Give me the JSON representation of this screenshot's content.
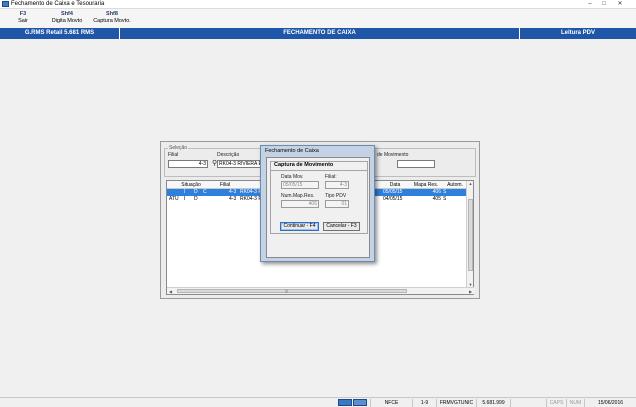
{
  "window": {
    "title": "Fechamento de Caixa e Tesouraria",
    "min": "–",
    "max": "□",
    "close": "✕"
  },
  "toolbar": [
    {
      "key": "F3",
      "label": "Sair"
    },
    {
      "key": "Shf4",
      "label": "Digita Movto"
    },
    {
      "key": "Shf8",
      "label": "Captura Movto."
    }
  ],
  "header": {
    "system": "G.RMS Retail 5.681 RMS",
    "screen": "FECHAMENTO DE CAIXA",
    "mode": "Leitura PDV"
  },
  "selection": {
    "legend": "Seleção",
    "filial_label": "Filial",
    "filial_value": "4-3",
    "descricao_label": "Descrição",
    "descricao_value": "RK04-3 RIVIERA E",
    "data_mov_label": "de Movimento",
    "data_mov_value": ""
  },
  "grid": {
    "headers": [
      "Situação",
      "Filial",
      "Data",
      "Mapa Res.",
      "Autom."
    ],
    "rows": [
      {
        "s1": "",
        "s2": "I",
        "s3": "D",
        "s4": "C",
        "filial_num": "4-3",
        "filial_desc": "RK04-3 R",
        "data": "05/05/15",
        "mapa": "406",
        "autom": "S",
        "selected": true
      },
      {
        "s1": "ATU",
        "s2": "I",
        "s3": "D",
        "s4": "",
        "filial_num": "4-3",
        "filial_desc": "RK04-3 RI",
        "data": "04/05/15",
        "mapa": "405",
        "autom": "S",
        "selected": false
      }
    ],
    "hscroll_grip": "|||"
  },
  "dialog": {
    "title": "Fechamento de Caixa",
    "heading": "Captura de Movimento",
    "data_mov_label": "Data Mov.",
    "data_mov_value": "05/05/15",
    "filial_label": "Filial:",
    "filial_value": "4-3",
    "num_map_label": "Num.Map.Res.",
    "num_map_value": "406",
    "tipo_pdv_label": "Tipo PDV",
    "tipo_pdv_value": "01",
    "continue_button": "Continuar - F4",
    "cancel_button": "Cancelar - F3"
  },
  "statusbar": {
    "nfce": "NFCE",
    "range": "1-9",
    "user": "FRMVGTUNIC",
    "version": "5.681.999",
    "caps": "CAPS",
    "num": "NUM",
    "date": "15/06/2016"
  }
}
